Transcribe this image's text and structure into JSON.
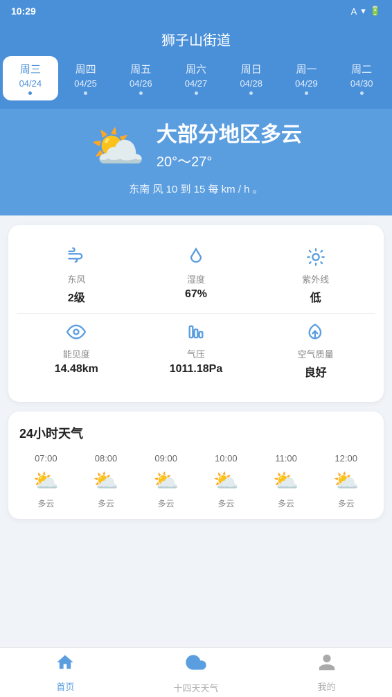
{
  "statusBar": {
    "time": "10:29",
    "icons": [
      "A",
      "▼",
      "🔋"
    ]
  },
  "header": {
    "title": "狮子山街道"
  },
  "weekDays": [
    {
      "day": "周三",
      "date": "04/24",
      "active": true
    },
    {
      "day": "周四",
      "date": "04/25",
      "active": false
    },
    {
      "day": "周五",
      "date": "04/26",
      "active": false
    },
    {
      "day": "周六",
      "date": "04/27",
      "active": false
    },
    {
      "day": "周日",
      "date": "04/28",
      "active": false
    },
    {
      "day": "周一",
      "date": "04/29",
      "active": false
    },
    {
      "day": "周二",
      "date": "04/30",
      "active": false
    }
  ],
  "weather": {
    "icon": "⛅",
    "description": "大部分地区多云",
    "tempRange": "20°～27°",
    "wind": "东南 风 10 到 15 每 km / h 。"
  },
  "stats": [
    {
      "icon": "wind",
      "label": "东风",
      "value": "2级"
    },
    {
      "icon": "humidity",
      "label": "湿度",
      "value": "67%"
    },
    {
      "icon": "uv",
      "label": "紫外线",
      "value": "低"
    },
    {
      "icon": "eye",
      "label": "能见度",
      "value": "14.48km"
    },
    {
      "icon": "pressure",
      "label": "气压",
      "value": "1011.18Pa"
    },
    {
      "icon": "air",
      "label": "空气质量",
      "value": "良好"
    }
  ],
  "hourly": {
    "title": "24小时天气",
    "items": [
      {
        "time": "07:00",
        "icon": "⛅",
        "desc": "多云"
      },
      {
        "time": "08:00",
        "icon": "⛅",
        "desc": "多云"
      },
      {
        "time": "09:00",
        "icon": "⛅",
        "desc": "多云"
      },
      {
        "time": "10:00",
        "icon": "⛅",
        "desc": "多云"
      },
      {
        "time": "11:00",
        "icon": "⛅",
        "desc": "多云"
      },
      {
        "time": "12:00",
        "icon": "⛅",
        "desc": "多云"
      }
    ]
  },
  "bottomNav": [
    {
      "id": "home",
      "icon": "home",
      "label": "首页",
      "active": true
    },
    {
      "id": "forecast",
      "icon": "cloud",
      "label": "十四天天气",
      "active": false
    },
    {
      "id": "profile",
      "icon": "person",
      "label": "我的",
      "active": false
    }
  ],
  "colors": {
    "primary": "#5b9ee0",
    "accent": "#4a90d9"
  }
}
